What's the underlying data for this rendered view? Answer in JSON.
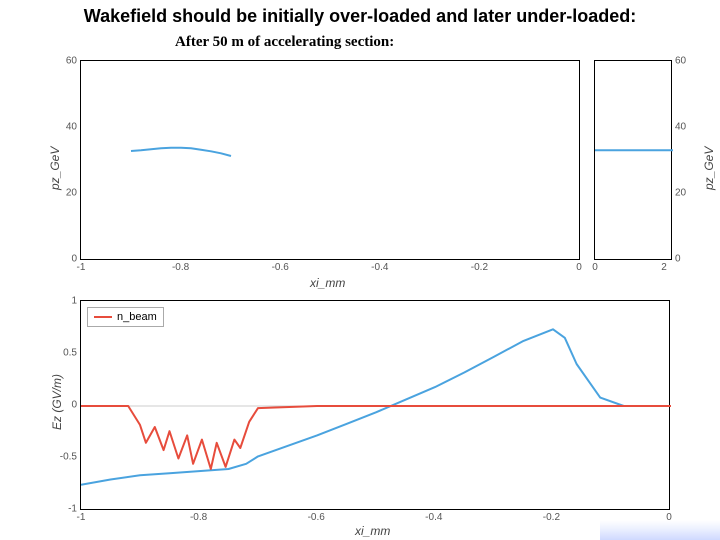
{
  "title": "Wakefield should be initially over-loaded and later under-loaded:",
  "subtitle": "After 50 m of accelerating section:",
  "labels": {
    "xi": "xi_mm",
    "pz": "pz_GeV",
    "ez": "Ez (GV/m)"
  },
  "legend": {
    "nbeam": "n_beam"
  },
  "chart_data": [
    {
      "id": "top_left",
      "type": "scatter",
      "title": "",
      "xlabel": "xi_mm",
      "ylabel": "pz_GeV",
      "xlim": [
        -1,
        0
      ],
      "ylim": [
        0,
        60
      ],
      "xticks": [
        -1,
        -0.8,
        -0.6,
        -0.4,
        -0.2,
        0
      ],
      "yticks": [
        0,
        20,
        40,
        60
      ],
      "series": [
        {
          "name": "pz_vs_xi",
          "color": "#4aa3df",
          "x": [
            -0.9,
            -0.88,
            -0.86,
            -0.84,
            -0.82,
            -0.8,
            -0.78,
            -0.76,
            -0.74,
            -0.72,
            -0.7
          ],
          "y": [
            33,
            33.2,
            33.5,
            33.8,
            34.0,
            34.0,
            33.8,
            33.4,
            32.9,
            32.3,
            31.5
          ]
        }
      ]
    },
    {
      "id": "top_right",
      "type": "scatter",
      "title": "",
      "xlabel": "",
      "ylabel_right": "pz_GeV",
      "xlim": [
        0,
        2.2
      ],
      "ylim": [
        0,
        60
      ],
      "xticks": [
        0,
        2
      ],
      "yticks": [
        0,
        20,
        40,
        60
      ],
      "series": [
        {
          "name": "pz_marginal",
          "color": "#4aa3df",
          "x": [
            0.0,
            0.2,
            0.5,
            1.0,
            1.5,
            2.0,
            2.2
          ],
          "y": [
            33.2,
            33.2,
            33.2,
            33.2,
            33.2,
            33.2,
            33.2
          ]
        }
      ]
    },
    {
      "id": "bottom",
      "type": "line",
      "title": "",
      "xlabel": "xi_mm",
      "ylabel": "Ez (GV/m)",
      "xlim": [
        -1,
        0
      ],
      "ylim": [
        -1,
        1
      ],
      "xticks": [
        -1,
        -0.8,
        -0.6,
        -0.4,
        -0.2,
        0
      ],
      "yticks": [
        -1,
        -0.5,
        0,
        0.5,
        1
      ],
      "series": [
        {
          "name": "Ez",
          "color": "#4aa3df",
          "x": [
            -1.0,
            -0.95,
            -0.9,
            -0.85,
            -0.8,
            -0.75,
            -0.72,
            -0.7,
            -0.65,
            -0.6,
            -0.55,
            -0.5,
            -0.45,
            -0.4,
            -0.35,
            -0.3,
            -0.25,
            -0.2,
            -0.18,
            -0.16,
            -0.12,
            -0.08,
            -0.04,
            0.0
          ],
          "y": [
            -0.75,
            -0.7,
            -0.66,
            -0.64,
            -0.62,
            -0.6,
            -0.55,
            -0.48,
            -0.38,
            -0.28,
            -0.17,
            -0.06,
            0.06,
            0.18,
            0.32,
            0.47,
            0.62,
            0.73,
            0.65,
            0.4,
            0.08,
            0.0,
            0.0,
            0.0
          ]
        },
        {
          "name": "n_beam",
          "color": "#e74c3c",
          "x": [
            -1.0,
            -0.92,
            -0.9,
            -0.89,
            -0.875,
            -0.86,
            -0.85,
            -0.835,
            -0.82,
            -0.81,
            -0.795,
            -0.78,
            -0.77,
            -0.755,
            -0.74,
            -0.73,
            -0.715,
            -0.7,
            -0.6,
            -0.4,
            -0.2,
            -0.05,
            0.0
          ],
          "y": [
            0.0,
            0.0,
            -0.18,
            -0.35,
            -0.2,
            -0.42,
            -0.24,
            -0.5,
            -0.28,
            -0.55,
            -0.32,
            -0.6,
            -0.35,
            -0.58,
            -0.32,
            -0.4,
            -0.15,
            -0.02,
            0.0,
            0.0,
            0.0,
            0.0,
            0.0
          ]
        }
      ]
    }
  ]
}
